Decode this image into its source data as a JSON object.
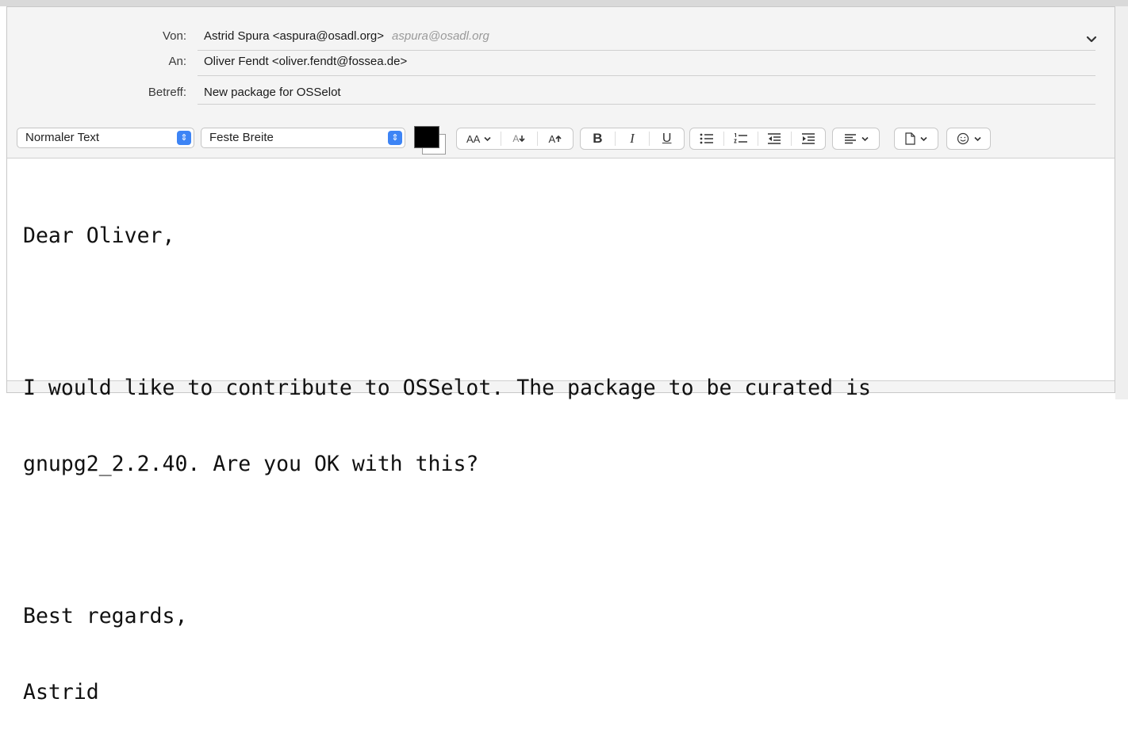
{
  "header": {
    "from_label": "Von:",
    "from_value": "Astrid Spura <aspura@osadl.org>",
    "from_alias": "aspura@osadl.org",
    "to_label": "An:",
    "to_value": "Oliver Fendt <oliver.fendt@fossea.de>",
    "subject_label": "Betreff:",
    "subject_value": "New package for OSSelot"
  },
  "toolbar": {
    "paragraph_style": "Normaler Text",
    "font_family": "Feste Breite",
    "text_color": "#000000",
    "font_size_label": "AA",
    "decrease_size_label": "A",
    "increase_size_label": "A",
    "bold_label": "B",
    "italic_label": "I",
    "underline_label": "U"
  },
  "message": {
    "greeting": "Dear Oliver,",
    "line1": "I would like to contribute to OSSelot. The package to be curated is",
    "line2": "gnupg2_2.2.40. Are you OK with this?",
    "closing": "Best regards,",
    "signature": "Astrid"
  }
}
